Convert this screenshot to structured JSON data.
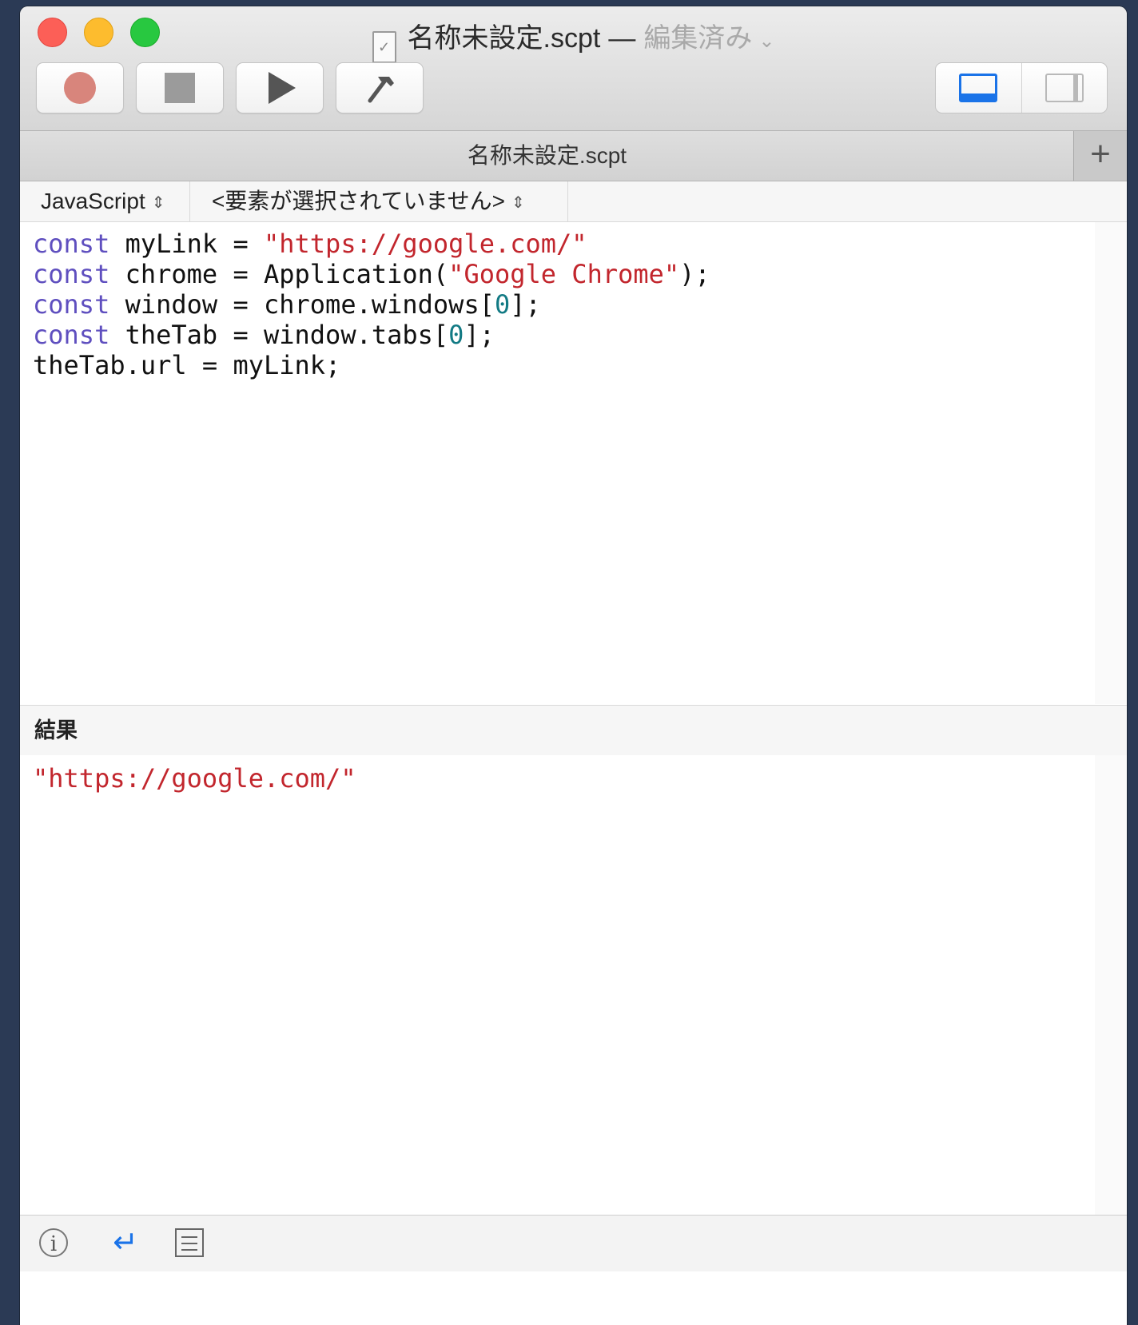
{
  "window": {
    "title": "名称未設定.scpt",
    "title_separator": "—",
    "edited_label": "編集済み",
    "caret": "⌄"
  },
  "toolbar": {
    "buttons": [
      {
        "name": "record",
        "icon": "record-icon"
      },
      {
        "name": "stop",
        "icon": "stop-icon"
      },
      {
        "name": "run",
        "icon": "play-icon"
      },
      {
        "name": "compile",
        "icon": "hammer-icon"
      }
    ],
    "view_toggle": [
      "bottom-pane-icon",
      "side-pane-icon"
    ]
  },
  "tabs": {
    "active_label": "名称未設定.scpt",
    "add_label": "+"
  },
  "navigation": {
    "language": "JavaScript",
    "element": "<要素が選択されていません>"
  },
  "editor": {
    "lines": [
      [
        {
          "t": "kw",
          "v": "const"
        },
        {
          "t": "plain",
          "v": " myLink = "
        },
        {
          "t": "str",
          "v": "\"https://google.com/\""
        }
      ],
      [
        {
          "t": "kw",
          "v": "const"
        },
        {
          "t": "plain",
          "v": " chrome = Application("
        },
        {
          "t": "str",
          "v": "\"Google Chrome\""
        },
        {
          "t": "plain",
          "v": ");"
        }
      ],
      [
        {
          "t": "kw",
          "v": "const"
        },
        {
          "t": "plain",
          "v": " window = chrome.windows["
        },
        {
          "t": "num",
          "v": "0"
        },
        {
          "t": "plain",
          "v": "];"
        }
      ],
      [
        {
          "t": "kw",
          "v": "const"
        },
        {
          "t": "plain",
          "v": " theTab = window.tabs["
        },
        {
          "t": "num",
          "v": "0"
        },
        {
          "t": "plain",
          "v": "];"
        }
      ],
      [
        {
          "t": "plain",
          "v": "theTab.url = myLink;"
        }
      ]
    ]
  },
  "result": {
    "header": "結果",
    "value": "\"https://google.com/\""
  },
  "statusbar": {
    "info_glyph": "i",
    "return_glyph": "↵"
  },
  "colors": {
    "keyword": "#5f4fbf",
    "string": "#c2262d",
    "number": "#127a84",
    "accent": "#1a73e8"
  }
}
